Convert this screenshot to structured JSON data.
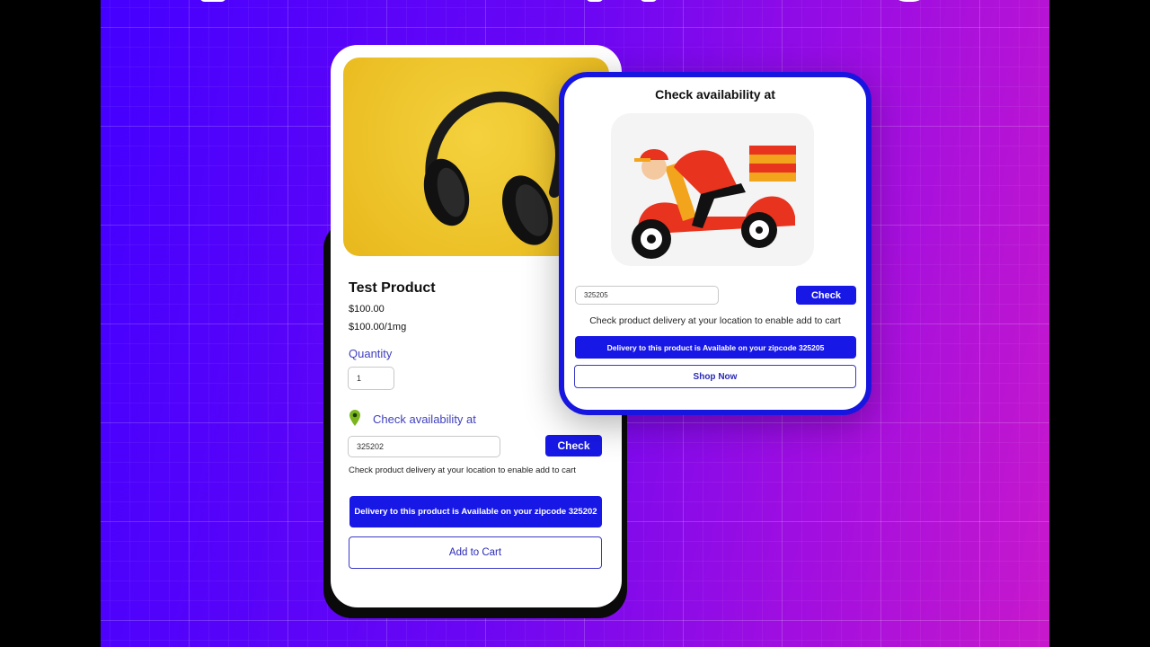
{
  "product_card": {
    "title": "Test Product",
    "price": "$100.00",
    "unit_price": "$100.00/1mg",
    "quantity_label": "Quantity",
    "quantity_value": "1",
    "availability_label": "Check availability at",
    "zipcode_value": "325202",
    "check_label": "Check",
    "hint": "Check product delivery at your location to enable add to cart",
    "status": "Delivery to this product is Available on your zipcode 325202",
    "add_to_cart_label": "Add to Cart"
  },
  "popup": {
    "title": "Check availability at",
    "zipcode_value": "325205",
    "check_label": "Check",
    "hint": "Check product delivery at your location to enable add to cart",
    "status": "Delivery to this product is Available on your zipcode 325205",
    "shop_now_label": "Shop Now"
  },
  "colors": {
    "accent": "#1818e6",
    "label": "#4040c0",
    "pin": "#7ab51d"
  },
  "icons": [
    "location-pin-icon"
  ]
}
